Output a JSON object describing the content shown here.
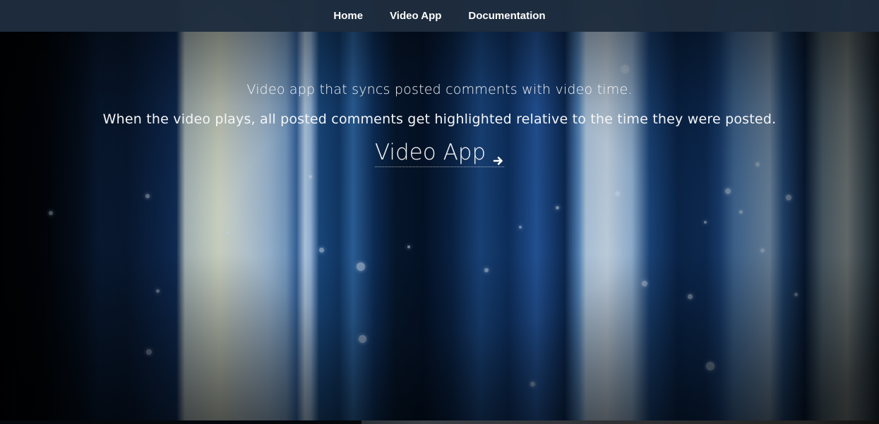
{
  "nav": {
    "items": [
      {
        "label": "Home"
      },
      {
        "label": "Video App"
      },
      {
        "label": "Documentation"
      }
    ]
  },
  "hero": {
    "line1": "Video app that syncs posted comments with video time.",
    "line2": "When the video plays, all posted comments get highlighted relative to the time they were posted.",
    "cta_label": "Video App",
    "cta_icon": "arrow-right-icon"
  },
  "colors": {
    "navbar_bg": "#1e2d3e",
    "text": "#ffffff"
  }
}
